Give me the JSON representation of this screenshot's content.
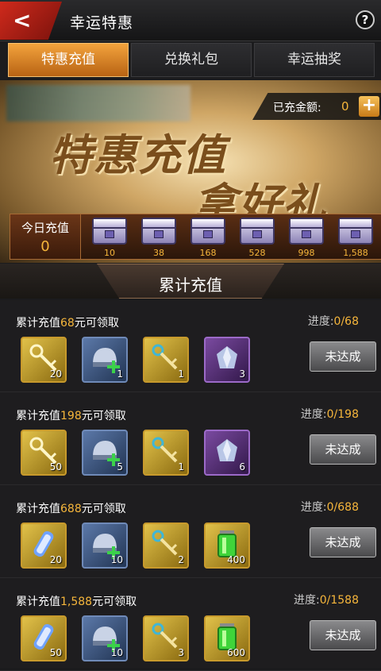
{
  "header": {
    "title": "幸运特惠",
    "back_icon": "back-arrow-icon",
    "help_label": "?"
  },
  "tabs": [
    {
      "label": "特惠充值",
      "active": true
    },
    {
      "label": "兑换礼包",
      "active": false
    },
    {
      "label": "幸运抽奖",
      "active": false
    }
  ],
  "banner": {
    "paid_label": "已充金额:",
    "paid_value": "0",
    "plus_label": "+",
    "headline_1": "特惠充值",
    "headline_2": "拿好礼",
    "today_label": "今日充值",
    "today_value": "0",
    "chest_values": [
      "10",
      "38",
      "168",
      "528",
      "998",
      "1,588"
    ]
  },
  "section_title": "累计充值",
  "rows": [
    {
      "prefix": "累计充值",
      "amount": "68",
      "suffix": "元可领取",
      "progress_label": "进度:",
      "progress": "0/68",
      "button": "未达成",
      "items": [
        {
          "type": "gold",
          "icon": "key-icon",
          "count": "20"
        },
        {
          "type": "blue",
          "icon": "helmet-icon",
          "count": "1"
        },
        {
          "type": "gold",
          "icon": "chain-key-icon",
          "count": "1"
        },
        {
          "type": "purple",
          "icon": "crystal-icon",
          "count": "3"
        }
      ]
    },
    {
      "prefix": "累计充值",
      "amount": "198",
      "suffix": "元可领取",
      "progress_label": "进度:",
      "progress": "0/198",
      "button": "未达成",
      "items": [
        {
          "type": "gold",
          "icon": "key-icon",
          "count": "50"
        },
        {
          "type": "blue",
          "icon": "helmet-icon",
          "count": "5"
        },
        {
          "type": "gold",
          "icon": "chain-key-icon",
          "count": "1"
        },
        {
          "type": "purple",
          "icon": "crystal-icon",
          "count": "6"
        }
      ]
    },
    {
      "prefix": "累计充值",
      "amount": "688",
      "suffix": "元可领取",
      "progress_label": "进度:",
      "progress": "0/688",
      "button": "未达成",
      "items": [
        {
          "type": "gold",
          "icon": "capsule-icon",
          "count": "20"
        },
        {
          "type": "blue",
          "icon": "helmet-icon",
          "count": "10"
        },
        {
          "type": "gold",
          "icon": "chain-key-icon",
          "count": "2"
        },
        {
          "type": "gold",
          "icon": "battery-icon",
          "count": "400"
        }
      ]
    },
    {
      "prefix": "累计充值",
      "amount": "1,588",
      "suffix": "元可领取",
      "progress_label": "进度:",
      "progress": "0/1588",
      "button": "未达成",
      "items": [
        {
          "type": "gold",
          "icon": "capsule-icon",
          "count": "50"
        },
        {
          "type": "blue",
          "icon": "helmet-icon",
          "count": "10"
        },
        {
          "type": "gold",
          "icon": "chain-key-icon",
          "count": "3"
        },
        {
          "type": "gold",
          "icon": "battery-icon",
          "count": "600"
        }
      ]
    }
  ]
}
